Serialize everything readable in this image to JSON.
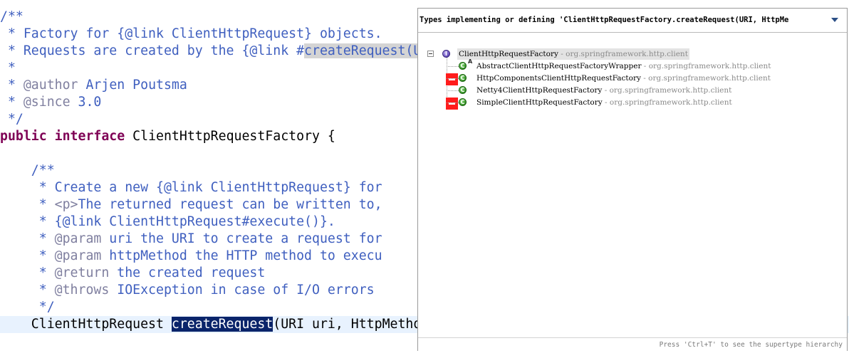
{
  "editor": {
    "lines": [
      {
        "segments": [
          {
            "t": "/**",
            "c": "jd"
          }
        ]
      },
      {
        "segments": [
          {
            "t": " * Factory for {@link ClientHttpRequest} objects.",
            "c": "jd"
          }
        ]
      },
      {
        "segments": [
          {
            "t": " * Requests are created by the {@link #",
            "c": "jd"
          },
          {
            "t": "createRequest(URI, HttpMethod)",
            "c": "jd hl-occ"
          }
        ]
      },
      {
        "segments": [
          {
            "t": " *",
            "c": "jd"
          }
        ]
      },
      {
        "segments": [
          {
            "t": " * ",
            "c": "jd"
          },
          {
            "t": "@author",
            "c": "tag"
          },
          {
            "t": " Arjen Poutsma",
            "c": "jd"
          }
        ]
      },
      {
        "segments": [
          {
            "t": " * ",
            "c": "jd"
          },
          {
            "t": "@since",
            "c": "tag"
          },
          {
            "t": " 3.0",
            "c": "jd"
          }
        ]
      },
      {
        "segments": [
          {
            "t": " */",
            "c": "jd"
          }
        ]
      },
      {
        "segments": [
          {
            "t": "public",
            "c": "kw"
          },
          {
            "t": " ",
            "c": "plain"
          },
          {
            "t": "interface",
            "c": "kw"
          },
          {
            "t": " ClientHttpRequestFactory {",
            "c": "plain"
          }
        ]
      },
      {
        "segments": [
          {
            "t": "",
            "c": "plain"
          }
        ]
      },
      {
        "segments": [
          {
            "t": "    /**",
            "c": "jd"
          }
        ]
      },
      {
        "segments": [
          {
            "t": "     * Create a new {@link ClientHttpRequest} for",
            "c": "jd"
          }
        ]
      },
      {
        "segments": [
          {
            "t": "     * ",
            "c": "jd"
          },
          {
            "t": "<p>",
            "c": "tag"
          },
          {
            "t": "The returned request can be written to,",
            "c": "jd"
          }
        ]
      },
      {
        "segments": [
          {
            "t": "     * {@link ClientHttpRequest#execute()}.",
            "c": "jd"
          }
        ]
      },
      {
        "segments": [
          {
            "t": "     * ",
            "c": "jd"
          },
          {
            "t": "@param",
            "c": "tag"
          },
          {
            "t": " uri the URI to create a request for",
            "c": "jd"
          }
        ]
      },
      {
        "segments": [
          {
            "t": "     * ",
            "c": "jd"
          },
          {
            "t": "@param",
            "c": "tag"
          },
          {
            "t": " httpMethod the HTTP method to execu",
            "c": "jd"
          }
        ]
      },
      {
        "segments": [
          {
            "t": "     * ",
            "c": "jd"
          },
          {
            "t": "@return",
            "c": "tag"
          },
          {
            "t": " the created request",
            "c": "jd"
          }
        ]
      },
      {
        "segments": [
          {
            "t": "     * ",
            "c": "jd"
          },
          {
            "t": "@throws",
            "c": "tag"
          },
          {
            "t": " IOException in case of I/O errors",
            "c": "jd"
          }
        ]
      },
      {
        "segments": [
          {
            "t": "     */",
            "c": "jd"
          }
        ]
      },
      {
        "segments": [
          {
            "t": "    ClientHttpRequest ",
            "c": "plain"
          },
          {
            "t": "createRequest",
            "c": "sel"
          },
          {
            "t": "(URI uri, HttpMethod httpMethod) throws IOException;",
            "c": "plain"
          }
        ],
        "current": true
      }
    ]
  },
  "popup": {
    "title": "Types implementing or defining 'ClientHttpRequestFactory.createRequest(URI, HttpMe",
    "menu_icon": "chevron-down-icon",
    "root": {
      "name": "ClientHttpRequestFactory",
      "package": " - org.springframework.http.client",
      "icon": "interface-icon",
      "icon_letter": "I"
    },
    "children": [
      {
        "name": "AbstractClientHttpRequestFactoryWrapper",
        "package": " - org.springframework.http.client",
        "icon": "class-icon",
        "icon_letter": "C",
        "overlay": "A",
        "marker": false
      },
      {
        "name": "HttpComponentsClientHttpRequestFactory",
        "package": " - org.springframework.http.client",
        "icon": "class-icon",
        "icon_letter": "C",
        "marker": true
      },
      {
        "name": "Netty4ClientHttpRequestFactory",
        "package": " - org.springframework.http.client",
        "icon": "class-icon",
        "icon_letter": "C",
        "marker": false
      },
      {
        "name": "SimpleClientHttpRequestFactory",
        "package": " - org.springframework.http.client",
        "icon": "class-icon",
        "icon_letter": "C",
        "marker": true
      }
    ],
    "footer": "Press 'Ctrl+T' to see the supertype hierarchy"
  }
}
